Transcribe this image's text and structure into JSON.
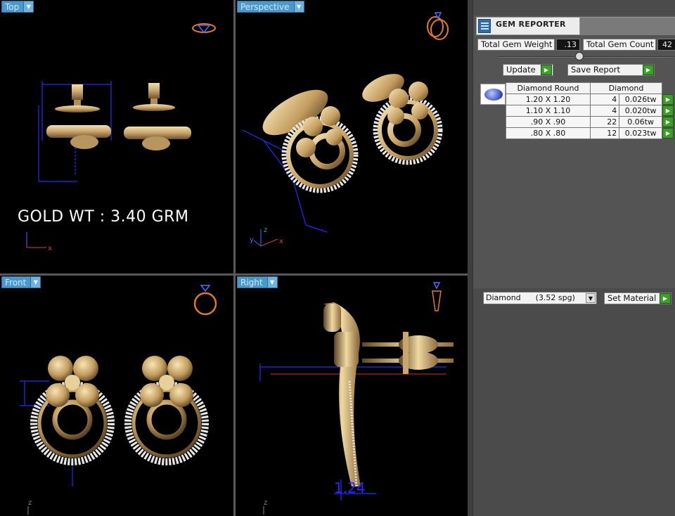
{
  "viewports": {
    "top": {
      "label": "Top"
    },
    "perspective": {
      "label": "Perspective"
    },
    "front": {
      "label": "Front"
    },
    "right": {
      "label": "Right"
    }
  },
  "overlay": {
    "gold_weight": "GOLD WT : 3.40 GRM",
    "right_dimension": "1.24"
  },
  "axes": {
    "x": "x",
    "y": "y",
    "z": "z"
  },
  "gem_reporter": {
    "title": "GEM REPORTER",
    "total_gem_weight_label": "Total Gem Weight",
    "total_gem_weight_value": ".13",
    "total_gem_count_label": "Total Gem Count",
    "total_gem_count_value": "42",
    "update_label": "Update",
    "save_report_label": "Save Report",
    "table": {
      "headers": [
        "Diamond Round",
        "Diamond"
      ],
      "rows": [
        {
          "size": "1.20 X 1.20",
          "count": "4",
          "weight": "0.026tw"
        },
        {
          "size": "1.10 X 1.10",
          "count": "4",
          "weight": "0.020tw"
        },
        {
          "size": ".90 X .90",
          "count": "22",
          "weight": "0.06tw"
        },
        {
          "size": ".80 X .80",
          "count": "12",
          "weight": "0.023tw"
        }
      ]
    },
    "material_select": "Diamond      (3.52 spg)",
    "set_material_label": "Set Material"
  },
  "colors": {
    "viewport_tab": "#4b98cc",
    "gold": "#d8b878",
    "dimension_lines": "#2a2aff",
    "go_button": "#3ca028"
  },
  "icons": {
    "viewport_menu": "chevron-down-icon",
    "go": "play-arrow-icon",
    "ring_gizmo": "ring-icon",
    "gem_reporter": "report-icon",
    "diamond": "diamond-gem-icon"
  }
}
